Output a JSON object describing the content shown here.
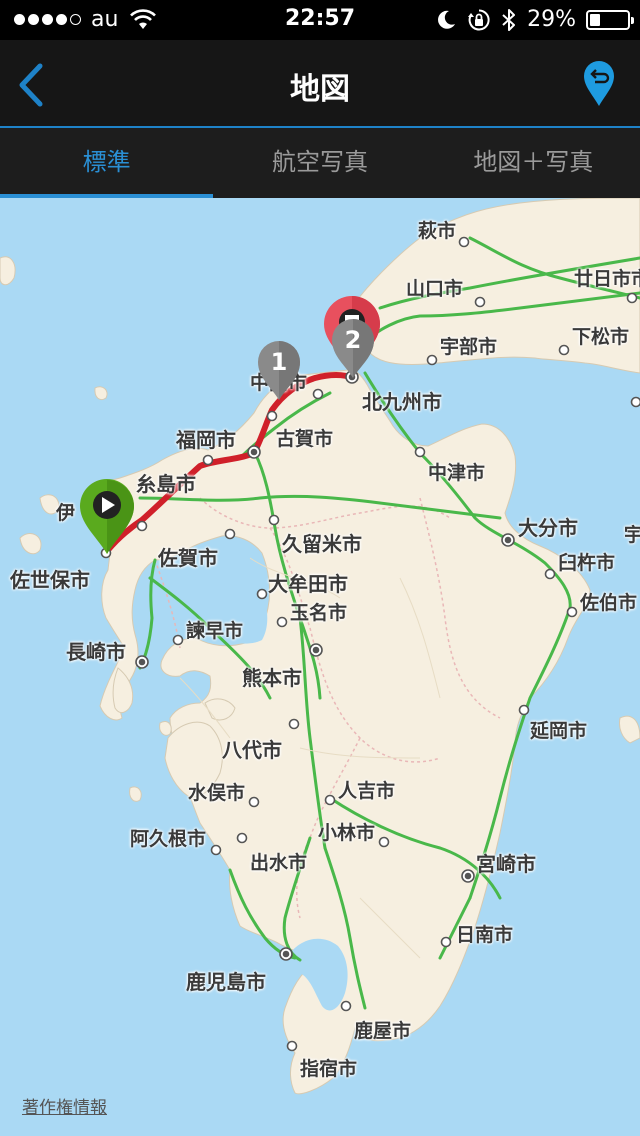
{
  "status_bar": {
    "carrier": "au",
    "time": "22:57",
    "battery_text": "29%",
    "battery_level": 0.29,
    "signal_dots_filled": 4,
    "signal_dots_total": 5
  },
  "nav": {
    "title": "地図",
    "back_icon": "chevron-left-icon",
    "route_icon": "route-pin-icon",
    "accent_color": "#1e82c8"
  },
  "tabs": [
    {
      "label": "標準",
      "active": true
    },
    {
      "label": "航空写真",
      "active": false
    },
    {
      "label": "地図＋写真",
      "active": false
    }
  ],
  "map": {
    "cities": [
      {
        "name": "萩市"
      },
      {
        "name": "山口市"
      },
      {
        "name": "廿日市市"
      },
      {
        "name": "宇部市"
      },
      {
        "name": "下松市"
      },
      {
        "name": "北九州市"
      },
      {
        "name": "中間市"
      },
      {
        "name": "福岡市"
      },
      {
        "name": "古賀市"
      },
      {
        "name": "中津市"
      },
      {
        "name": "糸島市"
      },
      {
        "name": "伊"
      },
      {
        "name": "大分市"
      },
      {
        "name": "宇"
      },
      {
        "name": "佐賀市"
      },
      {
        "name": "久留米市"
      },
      {
        "name": "臼杵市"
      },
      {
        "name": "佐世保市"
      },
      {
        "name": "大牟田市"
      },
      {
        "name": "佐伯市"
      },
      {
        "name": "玉名市"
      },
      {
        "name": "諫早市"
      },
      {
        "name": "長崎市"
      },
      {
        "name": "熊本市"
      },
      {
        "name": "延岡市"
      },
      {
        "name": "八代市"
      },
      {
        "name": "水俣市"
      },
      {
        "name": "人吉市"
      },
      {
        "name": "阿久根市"
      },
      {
        "name": "小林市"
      },
      {
        "name": "出水市"
      },
      {
        "name": "宮崎市"
      },
      {
        "name": "日南市"
      },
      {
        "name": "鹿児島市"
      },
      {
        "name": "鹿屋市"
      },
      {
        "name": "指宿市"
      }
    ],
    "pins": [
      {
        "type": "start",
        "icon": "play-icon",
        "color": "#5aaa1e"
      },
      {
        "type": "waypoint",
        "label": "1",
        "color": "#8a8a8a"
      },
      {
        "type": "waypoint",
        "label": "2",
        "color": "#8a8a8a"
      },
      {
        "type": "end",
        "color": "#e8505e"
      }
    ],
    "route_color": "#d0202a",
    "copyright": "著作権情報"
  }
}
